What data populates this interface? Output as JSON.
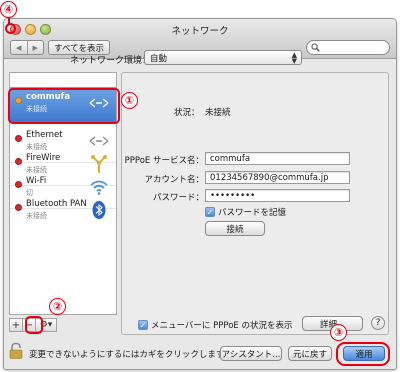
{
  "window": {
    "title": "ネットワーク"
  },
  "toolbar": {
    "back_icon": "◀",
    "forward_icon": "▶",
    "show_all_label": "すべてを表示",
    "search_placeholder": ""
  },
  "location": {
    "label": "ネットワーク環境：",
    "value": "自動"
  },
  "services": [
    {
      "name": "commufa",
      "status": "未接続",
      "dot_color": "#f0a030",
      "icon": "vpn-icon",
      "selected": true
    },
    {
      "name": "Ethernet",
      "status": "未接続",
      "dot_color": "#d8262c",
      "icon": "ethernet-icon",
      "selected": false
    },
    {
      "name": "FireWire",
      "status": "未接続",
      "dot_color": "#d8262c",
      "icon": "firewire-icon",
      "selected": false
    },
    {
      "name": "Wi-Fi",
      "status": "切",
      "dot_color": "#d8262c",
      "icon": "wifi-icon",
      "selected": false
    },
    {
      "name": "Bluetooth PAN",
      "status": "未接続",
      "dot_color": "#d8262c",
      "icon": "bluetooth-icon",
      "selected": false
    }
  ],
  "sidebar_tools": {
    "add": "+",
    "remove": "−",
    "gear": "⚙▾"
  },
  "detail": {
    "status_label": "状況：",
    "status_value": "未接続",
    "pppoe_label": "PPPoE サービス名：",
    "pppoe_value": "commufa",
    "account_label": "アカウント名：",
    "account_value": "01234567890@commufa.jp",
    "password_label": "パスワード：",
    "password_value": "•••••••••",
    "remember_label": "パスワードを記憶",
    "connect_label": "接続",
    "menubar_label": "メニューバーに PPPoE の状況を表示",
    "advanced_label": "詳細...",
    "help_label": "?"
  },
  "footer": {
    "lock_text": "変更できないようにするにはカギをクリックします。",
    "assistant_label": "アシスタント...",
    "revert_label": "元に戻す",
    "apply_label": "適用"
  },
  "annotations": {
    "n1": "①",
    "n2": "②",
    "n3": "③",
    "n4": "④"
  },
  "colors": {
    "annotation_red": "#e60012",
    "selection_blue": "#4a82d6"
  }
}
